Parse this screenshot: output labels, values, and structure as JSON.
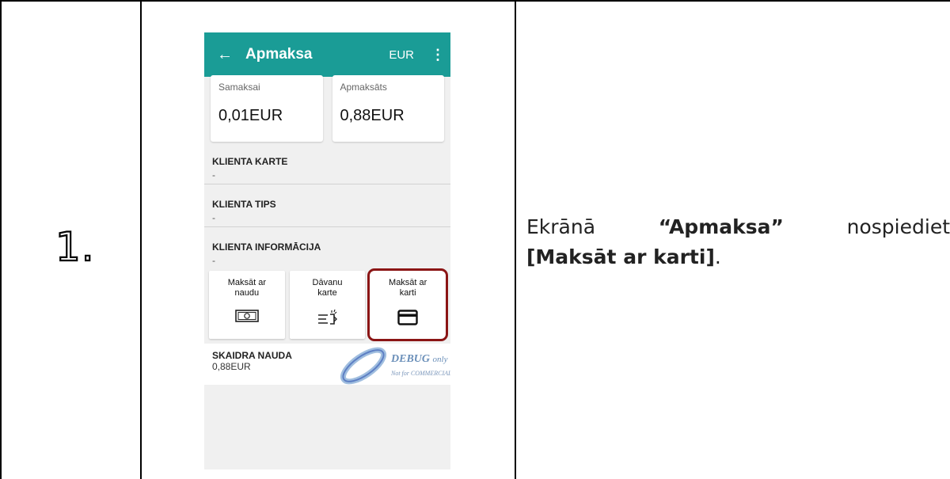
{
  "step": {
    "number": "1."
  },
  "instruction": {
    "prefix": "Ekrānā",
    "screen_name": "“Apmaksa”",
    "verb": "nospiediet",
    "button_name": "[Maksāt ar karti]",
    "suffix": "."
  },
  "app": {
    "toolbar": {
      "title": "Apmaksa",
      "currency": "EUR",
      "accent_color": "#1a9c96"
    },
    "summary": [
      {
        "label": "Samaksai",
        "value": "0,01EUR"
      },
      {
        "label": "Apmaksāts",
        "value": "0,88EUR"
      }
    ],
    "client_card": {
      "heading": "KLIENTA KARTE",
      "value": "-"
    },
    "client_type": {
      "heading": "KLIENTA TIPS",
      "value": "-"
    },
    "client_info": {
      "heading": "KLIENTA INFORMĀCIJA",
      "value": "-"
    },
    "payment_buttons": [
      {
        "line1": "Maksāt ar",
        "line2": "naudu",
        "icon": "cash-icon"
      },
      {
        "line1": "Dāvanu",
        "line2": "karte",
        "icon": "gift-card-icon"
      },
      {
        "line1": "Maksāt ar",
        "line2": "karti",
        "icon": "credit-card-icon"
      }
    ],
    "highlight_color": "#8b1515",
    "cash_payment": {
      "heading": "SKAIDRA NAUDA",
      "value": "0,88EUR"
    },
    "watermark": {
      "title": "DEBUG",
      "title_suffix": "only",
      "subtitle": "Not for COMMERCIAL"
    }
  }
}
